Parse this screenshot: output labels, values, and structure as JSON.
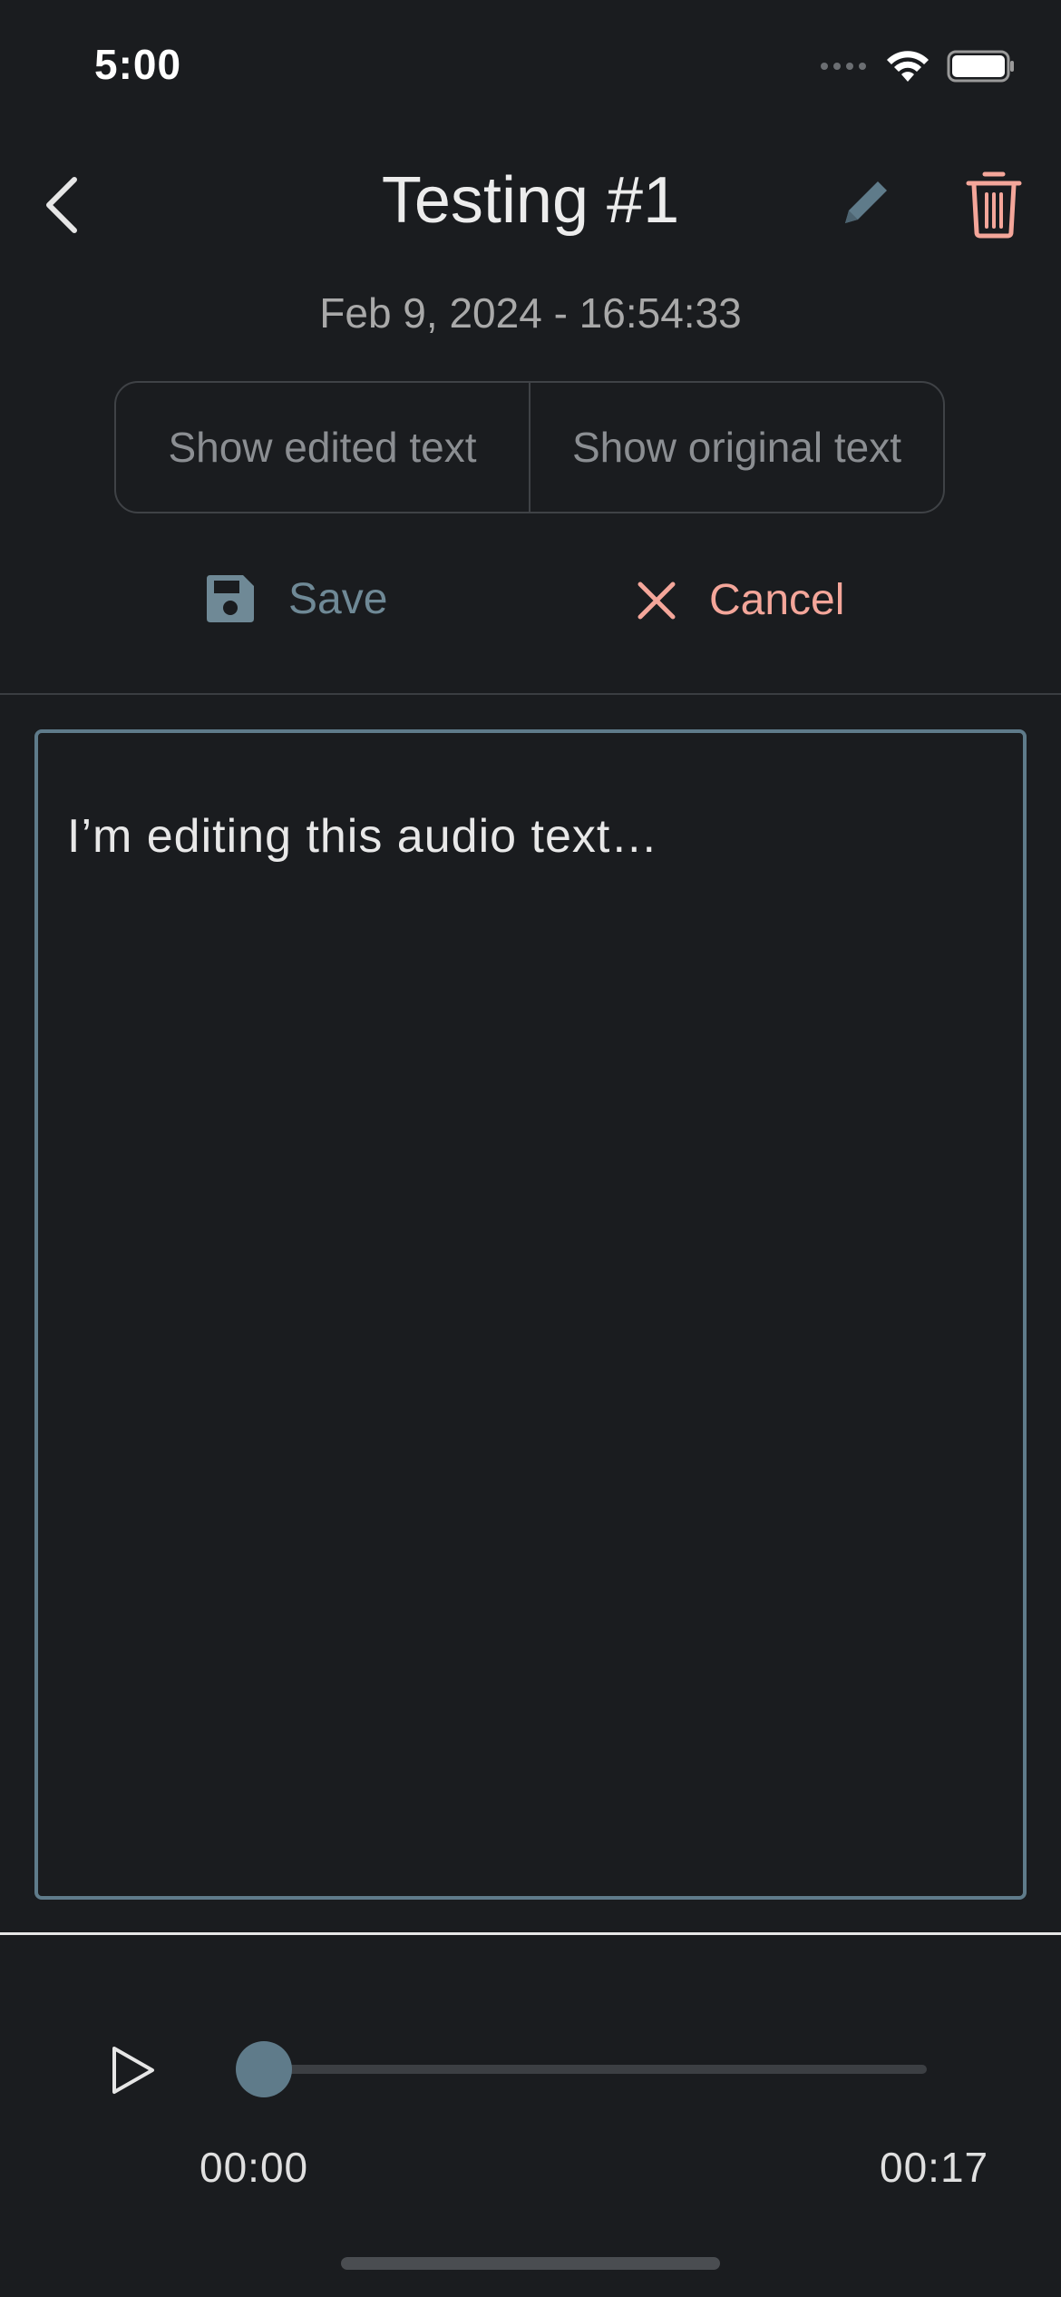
{
  "status_bar": {
    "time": "5:00"
  },
  "header": {
    "title": "Testing #1",
    "date": "Feb 9, 2024 - 16:54:33",
    "icons": {
      "back": "chevron-left-icon",
      "edit": "pencil-icon",
      "delete": "trash-icon"
    }
  },
  "segmented": {
    "edited_label": "Show edited text",
    "original_label": "Show original text"
  },
  "actions": {
    "save_label": "Save",
    "cancel_label": "Cancel"
  },
  "editor": {
    "text": "I’m editing this audio text…"
  },
  "player": {
    "current_time": "00:00",
    "duration": "00:17",
    "progress": 0
  },
  "colors": {
    "background": "#1a1c1f",
    "accent": "#5f7b8a",
    "cancel": "#f4a69a"
  }
}
